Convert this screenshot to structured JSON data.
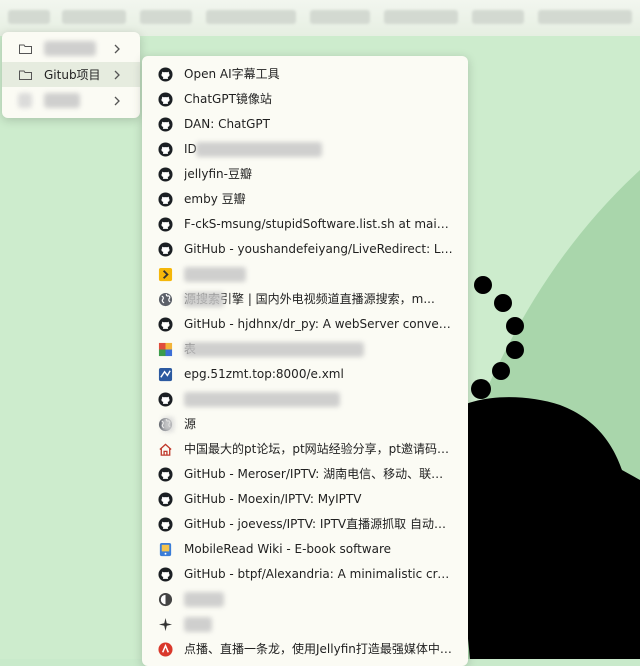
{
  "folders": [
    {
      "label": "",
      "icon": "folder-icon"
    },
    {
      "label": "Gitub项目",
      "icon": "folder-icon"
    },
    {
      "label": "",
      "icon": "folder-icon"
    }
  ],
  "bookmarks": [
    {
      "label": "Open AI字幕工具",
      "icon": "github-icon"
    },
    {
      "label": "ChatGPT镜像站",
      "icon": "github-icon"
    },
    {
      "label": "DAN: ChatGPT",
      "icon": "github-icon"
    },
    {
      "label": "ID",
      "icon": "github-icon"
    },
    {
      "label": "jellyfin-豆瓣",
      "icon": "github-icon"
    },
    {
      "label": "emby 豆瓣",
      "icon": "github-icon"
    },
    {
      "label": "F-ckS-msung/stupidSoftware.list.sh at main · rainb...",
      "icon": "github-icon"
    },
    {
      "label": "GitHub - youshandefeiyang/LiveRedirect: LiveRedi...",
      "icon": "github-icon"
    },
    {
      "label": "",
      "icon": "arrow-favicon"
    },
    {
      "label": "源搜索引擎 | 国内外电视频道直播源搜索，m...",
      "icon": "globe-icon"
    },
    {
      "label": "GitHub - hjdhnx/dr_py: A webServer convert web...",
      "icon": "github-icon"
    },
    {
      "label": "表",
      "icon": "colorful-favicon"
    },
    {
      "label": "epg.51zmt.top:8000/e.xml",
      "icon": "epg-favicon"
    },
    {
      "label": "",
      "icon": "github-icon"
    },
    {
      "label": "源",
      "icon": "globe-icon"
    },
    {
      "label": "中国最大的pt论坛，pt网站经验分享，pt邀请码赠送，...",
      "icon": "house-icon"
    },
    {
      "label": "GitHub - Meroser/IPTV: 湖南电信、移动、联通组播...",
      "icon": "github-icon"
    },
    {
      "label": "GitHub - Moexin/IPTV: MyIPTV",
      "icon": "github-icon"
    },
    {
      "label": "GitHub - joevess/IPTV: IPTV直播源抓取 自动整合好...",
      "icon": "github-icon"
    },
    {
      "label": "MobileRead Wiki - E-book software",
      "icon": "mobileread-favicon"
    },
    {
      "label": "GitHub - btpf/Alexandria: A minimalistic cross-plat...",
      "icon": "github-icon"
    },
    {
      "label": "",
      "icon": "half-circle-favicon"
    },
    {
      "label": "",
      "icon": "sparkle-icon"
    },
    {
      "label": "点播、直播一条龙，使用Jellyfin打造最强媒体中心（...",
      "icon": "red-circle-favicon"
    }
  ],
  "colors": {
    "background": "#c9eacb",
    "accent_green": "#a9d6ab",
    "silhouette": "#000000",
    "menu_bg": "#fbfbf4"
  }
}
